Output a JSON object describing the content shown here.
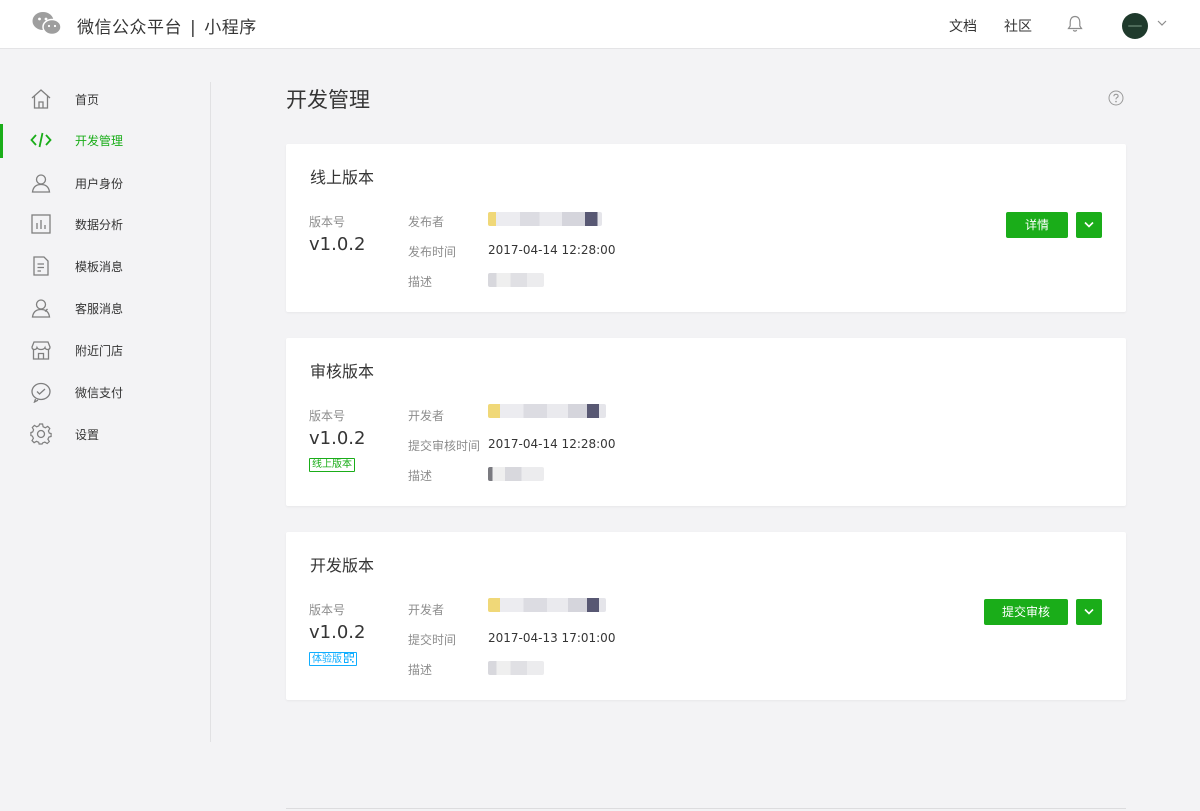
{
  "header": {
    "brand_name": "微信公众平台",
    "separator": "|",
    "product_name": "小程序",
    "nav_docs": "文档",
    "nav_community": "社区",
    "logo_icon": "wechat-logo-icon",
    "bell_icon": "bell-icon",
    "avatar_chevron_icon": "chevron-down-icon"
  },
  "sidebar": {
    "items": [
      {
        "label": "首页",
        "icon": "home-icon"
      },
      {
        "label": "开发管理",
        "icon": "code-icon",
        "active": true
      },
      {
        "label": "用户身份",
        "icon": "user-icon"
      },
      {
        "label": "数据分析",
        "icon": "bar-chart-icon"
      },
      {
        "label": "模板消息",
        "icon": "document-icon"
      },
      {
        "label": "客服消息",
        "icon": "customer-service-icon"
      },
      {
        "label": "附近门店",
        "icon": "store-icon"
      },
      {
        "label": "微信支付",
        "icon": "wechat-pay-icon"
      },
      {
        "label": "设置",
        "icon": "gear-icon"
      }
    ]
  },
  "main": {
    "title": "开发管理",
    "help_icon": "help-icon",
    "cards": [
      {
        "title": "线上版本",
        "version_label": "版本号",
        "version": "v1.0.2",
        "field1_label": "发布者",
        "field2_label": "发布时间",
        "field2_value": "2017-04-14 12:28:00",
        "field3_label": "描述",
        "primary_button": "详情"
      },
      {
        "title": "审核版本",
        "version_label": "版本号",
        "version": "v1.0.2",
        "badge": "线上版本",
        "field1_label": "开发者",
        "field2_label": "提交审核时间",
        "field2_value": "2017-04-14 12:28:00",
        "field3_label": "描述"
      },
      {
        "title": "开发版本",
        "version_label": "版本号",
        "version": "v1.0.2",
        "badge": "体验版",
        "field1_label": "开发者",
        "field2_label": "提交时间",
        "field2_value": "2017-04-13 17:01:00",
        "field3_label": "描述",
        "primary_button": "提交审核"
      }
    ]
  },
  "colors": {
    "accent": "#1aad19",
    "info": "#10aeff",
    "background": "#f3f3f5"
  }
}
